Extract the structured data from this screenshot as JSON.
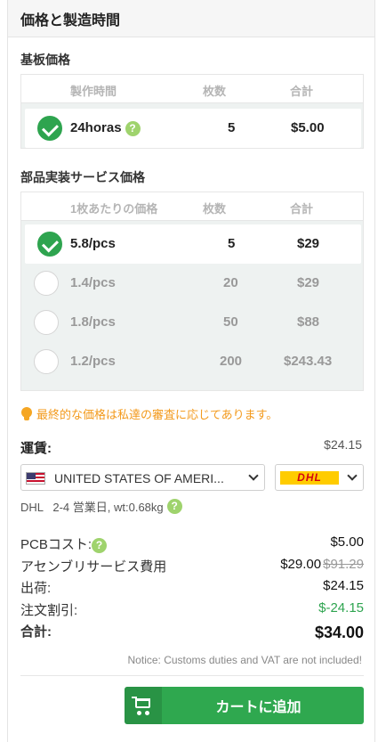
{
  "header": {
    "title": "価格と製造時間"
  },
  "board_price": {
    "title": "基板価格",
    "columns": [
      "製作時間",
      "枚数",
      "合計"
    ],
    "row": {
      "time": "24horas",
      "qty": "5",
      "total": "$5.00"
    }
  },
  "assembly_price": {
    "title": "部品実装サービス価格",
    "columns": [
      "1枚あたりの価格",
      "枚数",
      "合計"
    ],
    "rows": [
      {
        "unit": "5.8/pcs",
        "qty": "5",
        "total": "$29",
        "selected": true
      },
      {
        "unit": "1.4/pcs",
        "qty": "20",
        "total": "$29",
        "selected": false
      },
      {
        "unit": "1.8/pcs",
        "qty": "50",
        "total": "$88",
        "selected": false
      },
      {
        "unit": "1.2/pcs",
        "qty": "200",
        "total": "$243.43",
        "selected": false
      }
    ]
  },
  "final_notice": "最終的な価格は私達の審査に応じてあります。",
  "shipping": {
    "label": "運賃:",
    "amount": "$24.15",
    "country": "UNITED STATES OF AMERI...",
    "carrier": "DHL",
    "info": "DHL   2-4 営業日, wt:0.68kg"
  },
  "summary": {
    "pcb_cost_label": "PCBコスト:",
    "pcb_cost": "$5.00",
    "assembly_label": "アセンブリサービス費用",
    "assembly_cost": "$29.00",
    "assembly_original": "$91.29",
    "shipping_label": "出荷:",
    "shipping_cost": "$24.15",
    "discount_label": "注文割引:",
    "discount": "$-24.15",
    "total_label": "合計:",
    "total": "$34.00"
  },
  "customs_notice": "Notice: Customs duties and VAT are not included!",
  "cart_button": {
    "label": "カートに追加"
  },
  "help_glyph": "?",
  "colors": {
    "accent_green": "#2fa84f",
    "notice_orange": "#f39a1d",
    "discount_green": "#2ea44f"
  }
}
